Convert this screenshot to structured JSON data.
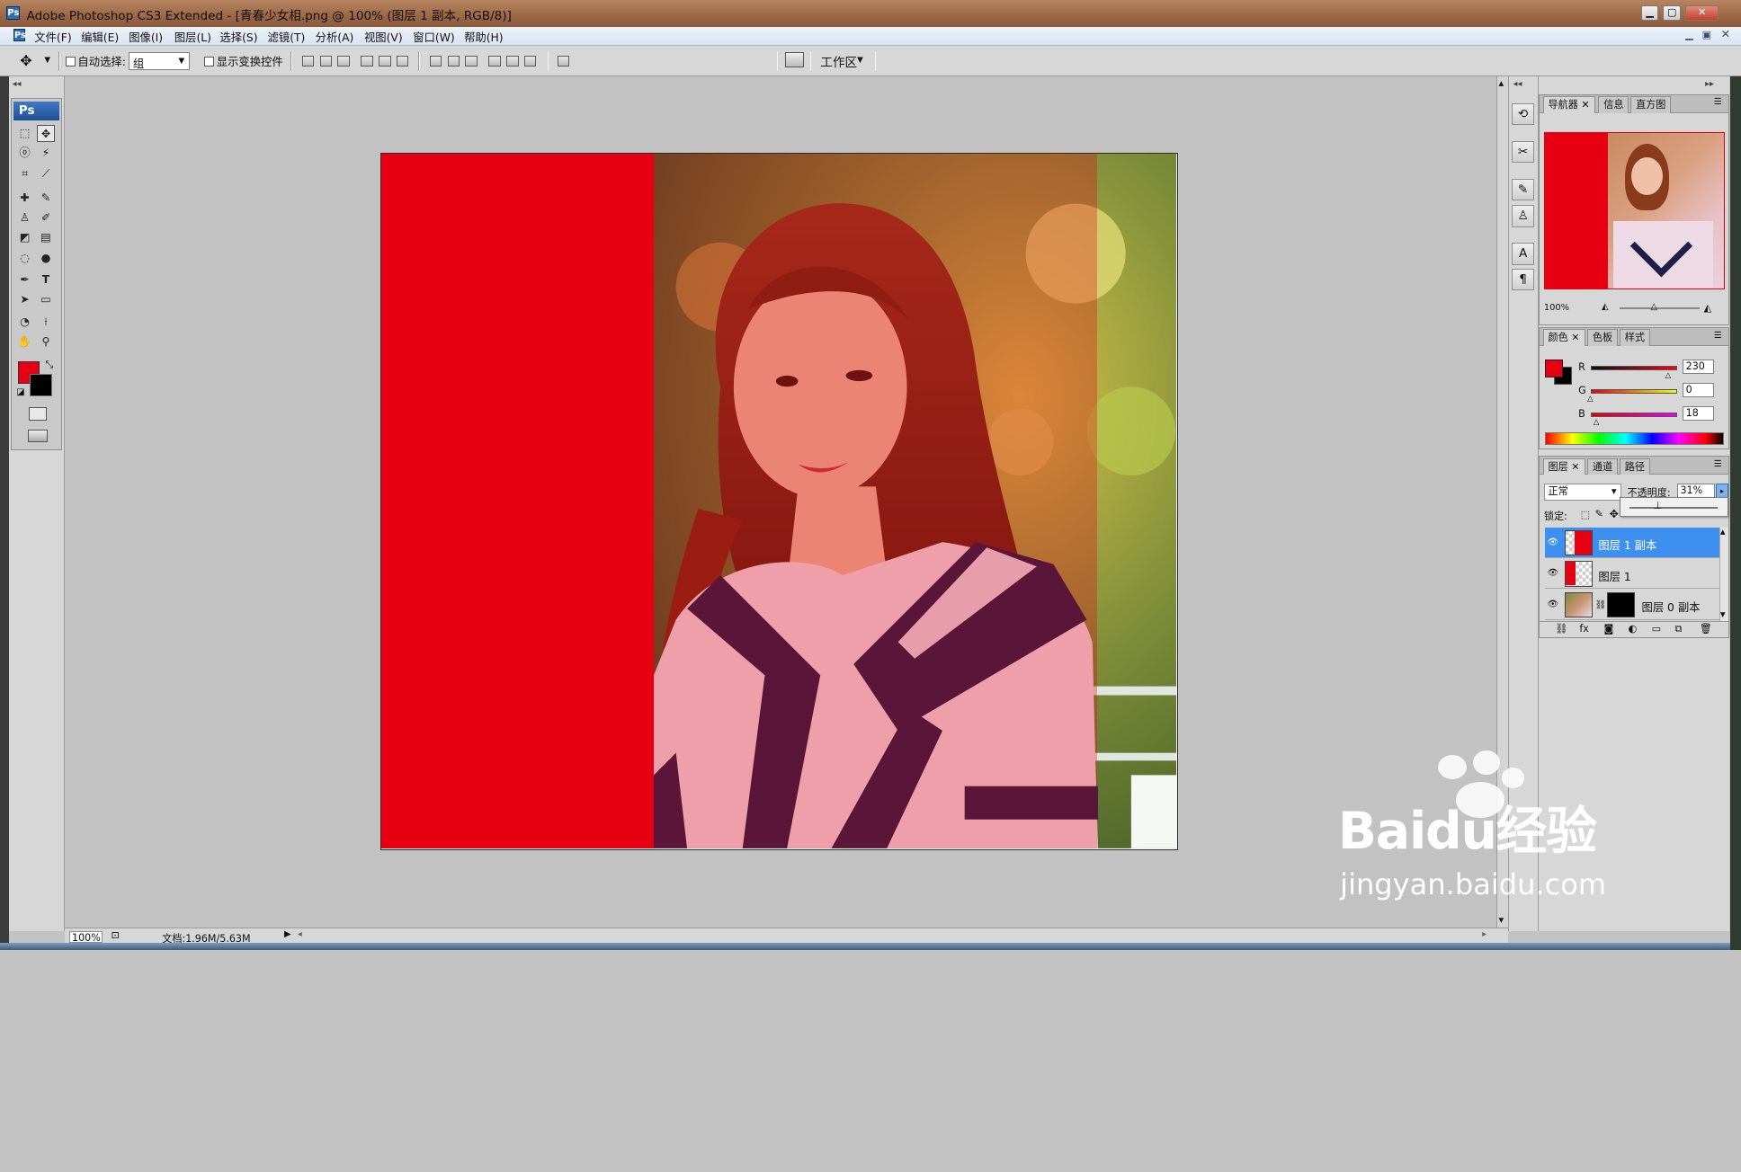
{
  "window": {
    "title": "Adobe Photoshop CS3 Extended - [青春少女相.png @ 100% (图层 1 副本, RGB/8)]",
    "minimize": "▁",
    "maximize": "▢",
    "close": "✕"
  },
  "menu": [
    "文件(F)",
    "编辑(E)",
    "图像(I)",
    "图层(L)",
    "选择(S)",
    "滤镜(T)",
    "分析(A)",
    "视图(V)",
    "窗口(W)",
    "帮助(H)"
  ],
  "options": {
    "auto_select_label": "自动选择:",
    "auto_select_value": "组",
    "show_transform_label": "显示变换控件",
    "workspace_label": "工作区"
  },
  "toolbox": {
    "logo": "Ps",
    "foreground_color": "#e60012",
    "background_color": "#000000"
  },
  "status": {
    "zoom": "100%",
    "doc_info": "文档:1.96M/5.63M"
  },
  "navigator": {
    "tabs": [
      "导航器",
      "信息",
      "直方图"
    ],
    "zoom": "100%"
  },
  "color_panel": {
    "tabs": [
      "颜色",
      "色板",
      "样式"
    ],
    "channels": [
      {
        "label": "R",
        "value": "230",
        "fraction": 0.9
      },
      {
        "label": "G",
        "value": "0",
        "fraction": 0.0
      },
      {
        "label": "B",
        "value": "18",
        "fraction": 0.07
      }
    ]
  },
  "layers_panel": {
    "tabs": [
      "图层",
      "通道",
      "路径"
    ],
    "blend_mode": "正常",
    "opacity_label": "不透明度:",
    "opacity_value": "31%",
    "opacity_fraction": 0.31,
    "lock_label": "锁定:",
    "layers": [
      {
        "name": "图层 1 副本",
        "selected": true
      },
      {
        "name": "图层 1",
        "selected": false
      },
      {
        "name": "图层 0 副本",
        "selected": false
      }
    ]
  },
  "watermark": {
    "brand": "Baidu经验",
    "url": "jingyan.baidu.com"
  },
  "colors": {
    "red_fill": "#e60012",
    "selection_blue": "#3d8ff0"
  }
}
